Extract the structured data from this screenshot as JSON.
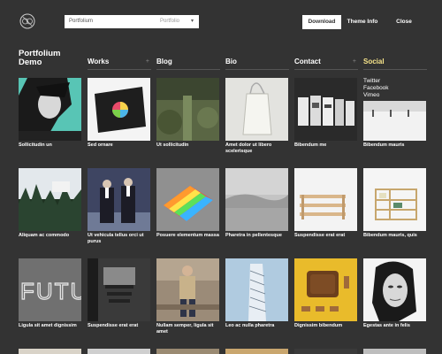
{
  "header": {
    "theme_name": "Portfolium",
    "theme_category": "Portfolio",
    "download_label": "Download",
    "theme_info_label": "Theme Info",
    "close_label": "Close",
    "dropdown_icon": "chevron-down-icon"
  },
  "site": {
    "title_line1": "Portfolium",
    "title_line2": "Demo"
  },
  "nav": [
    {
      "label": "Works",
      "has_plus": true
    },
    {
      "label": "Blog",
      "has_plus": false
    },
    {
      "label": "Bio",
      "has_plus": false
    },
    {
      "label": "Contact",
      "has_plus": true
    },
    {
      "label": "Social",
      "has_plus": false,
      "active": true
    }
  ],
  "social_links": [
    "Twitter",
    "Facebook",
    "Vimeo"
  ],
  "colors": {
    "background": "#333333",
    "accent": "#f7e48a",
    "button_bg": "#ffffff"
  },
  "grid": {
    "row1": [
      {
        "caption": "Sollicitudin un"
      },
      {
        "caption": "Sed ornare"
      },
      {
        "caption": "Ut sollicitudin"
      },
      {
        "caption": "Amet dolor ut libero scelerisque"
      },
      {
        "caption": "Bibendum me"
      },
      {
        "caption": "Bibendum mauris"
      }
    ],
    "row2": [
      {
        "caption": "Aliquam ac commodo"
      },
      {
        "caption": "Ut vehicula tellus orci ut purus"
      },
      {
        "caption": "Posuere elementum massa"
      },
      {
        "caption": "Pharetra in pellentesque"
      },
      {
        "caption": "Suspendisse erat erat"
      },
      {
        "caption": "Bibendum mauris, quis"
      }
    ],
    "row3": [
      {
        "caption": "Ligula sit amet dignissim",
        "art_text": "FUTU"
      },
      {
        "caption": "Suspendisse erat erat"
      },
      {
        "caption": "Nullam semper, ligula sit amet"
      },
      {
        "caption": "Leo ac nulla pharetra"
      },
      {
        "caption": "Dignissim bibendum"
      },
      {
        "caption": "Egestas ante in felis"
      }
    ]
  }
}
